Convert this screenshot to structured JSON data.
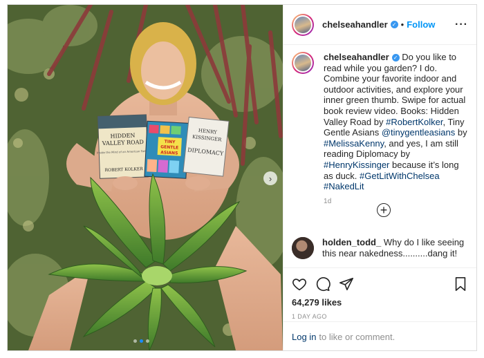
{
  "post": {
    "username": "chelseahandler",
    "follow_label": "Follow",
    "bullet": "•",
    "more_label": "···"
  },
  "photo": {
    "book1_line1": "HIDDEN",
    "book1_line2": "VALLEY ROAD",
    "book1_line3": "Inside the Mind of an American Family",
    "book1_author": "ROBERT KOLKER",
    "book2_title1": "TINY",
    "book2_title2": "GENTLE",
    "book2_title3": "ASIANS",
    "book3_line1": "HENRY",
    "book3_line2": "KISSINGER",
    "book3_line3": "DIPLOMACY",
    "next_arrow": "›",
    "dot_count": 3,
    "active_dot": 2
  },
  "caption": {
    "username": "chelseahandler",
    "parts": [
      {
        "t": " Do you like to read while you garden? I do. Combine your favorite indoor and outdoor activities, and explore your inner green thumb. Swipe for actual book review video. Books: Hidden Valley Road by ",
        "link": false
      },
      {
        "t": "#RobertKolker",
        "link": true
      },
      {
        "t": ", Tiny Gentle Asians ",
        "link": false
      },
      {
        "t": "@tinygentleasians",
        "link": true
      },
      {
        "t": " by ",
        "link": false
      },
      {
        "t": "#MelissaKenny",
        "link": true
      },
      {
        "t": ", and yes, I am still reading Diplomacy by ",
        "link": false
      },
      {
        "t": "#HenryKissinger",
        "link": true
      },
      {
        "t": " because it’s long as duck. ",
        "link": false
      },
      {
        "t": "#GetLitWithChelsea",
        "link": true
      },
      {
        "t": " ",
        "link": false
      },
      {
        "t": "#NakedLit",
        "link": true
      }
    ],
    "time": "1d",
    "load_more": "+"
  },
  "comment": {
    "username": "holden_todd_",
    "text": " Why do I like seeing this near nakedness..........dang it!"
  },
  "actions": {
    "likes": "64,279 likes",
    "date": "1 DAY AGO"
  },
  "login": {
    "link_label": "Log in",
    "rest": "to like or comment."
  },
  "colors": {
    "link": "#00376b",
    "follow": "#0095f6",
    "verified": "#3897f0"
  }
}
